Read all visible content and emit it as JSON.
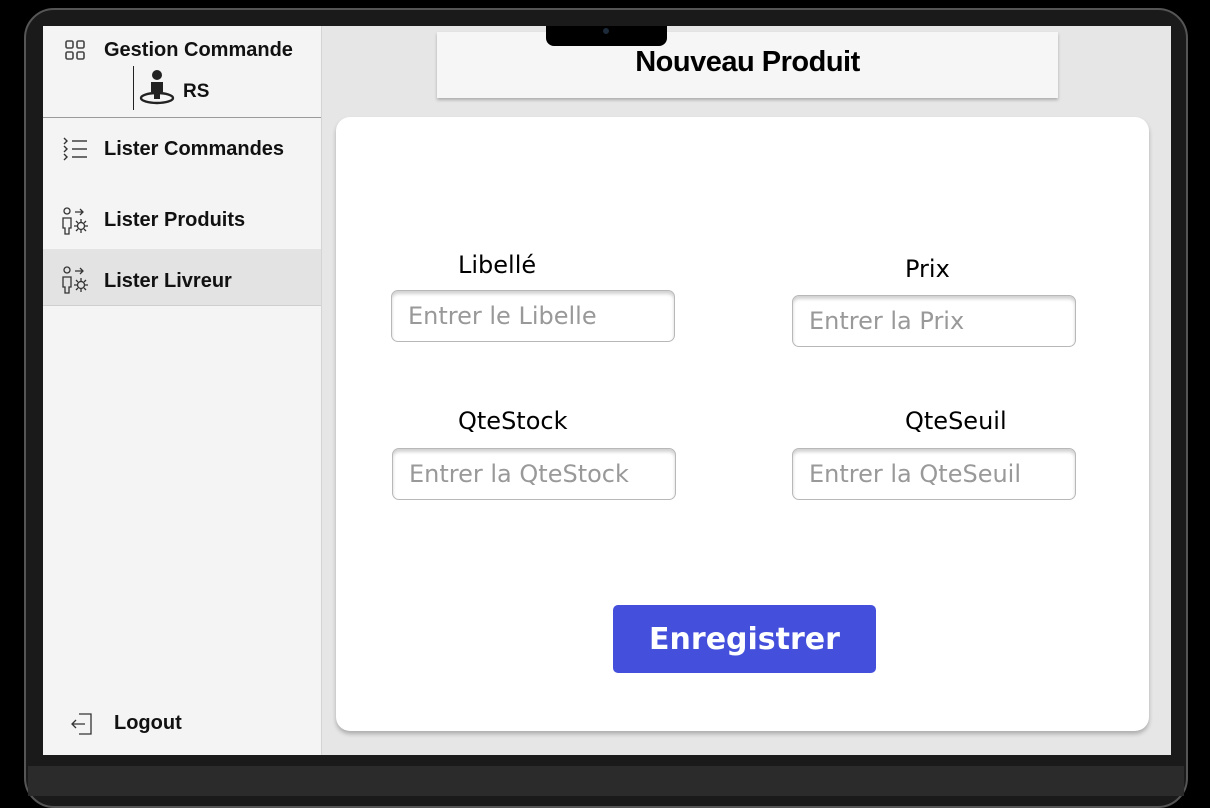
{
  "app": {
    "title": "Gestion Commande",
    "user": "RS"
  },
  "sidebar": {
    "items": [
      {
        "label": "Lister Commandes",
        "icon": "list-icon"
      },
      {
        "label": "Lister Produits",
        "icon": "users-settings-icon"
      },
      {
        "label": "Lister Livreur",
        "icon": "users-settings-icon",
        "active": true
      }
    ],
    "logout_label": "Logout"
  },
  "page": {
    "title": "Nouveau Produit"
  },
  "form": {
    "fields": [
      {
        "label": "Libellé",
        "placeholder": "Entrer le Libelle"
      },
      {
        "label": "Prix",
        "placeholder": "Entrer la Prix"
      },
      {
        "label": "QteStock",
        "placeholder": "Entrer la QteStock"
      },
      {
        "label": "QteSeuil",
        "placeholder": "Entrer la QteSeuil"
      }
    ],
    "submit_label": "Enregistrer"
  },
  "colors": {
    "accent": "#4450db",
    "sidebar_bg": "#f4f4f4",
    "active_item_bg": "#e3e3e3",
    "screen_bg": "#e6e6e6"
  }
}
